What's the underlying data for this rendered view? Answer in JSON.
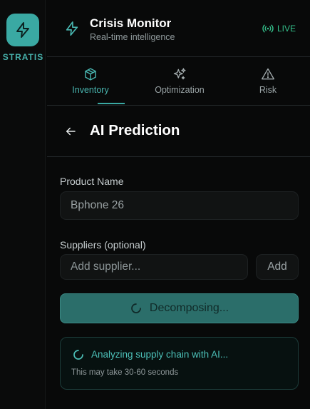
{
  "brand": {
    "name": "STRATIS",
    "logo_icon": "lightning-icon",
    "accent": "#3aa9a3"
  },
  "header": {
    "title": "Crisis Monitor",
    "subtitle": "Real-time intelligence",
    "header_icon": "lightning-icon",
    "live_label": "LIVE",
    "live_icon": "broadcast-icon",
    "live_color": "#34c08b"
  },
  "tabs": [
    {
      "label": "Inventory",
      "icon": "box-icon",
      "active": true
    },
    {
      "label": "Optimization",
      "icon": "sparkles-icon",
      "active": false
    },
    {
      "label": "Risk",
      "icon": "warning-icon",
      "active": false
    }
  ],
  "page": {
    "title": "AI Prediction",
    "back_icon": "arrow-left-icon"
  },
  "form": {
    "product_label": "Product Name",
    "product_value": "Bphone 26",
    "suppliers_label": "Suppliers (optional)",
    "supplier_placeholder": "Add supplier...",
    "add_label": "Add",
    "submit_label": "Decomposing...",
    "submit_icon": "spinner-icon"
  },
  "status": {
    "message": "Analyzing supply chain with AI...",
    "note": "This may take 30-60 seconds",
    "icon": "spinner-icon"
  }
}
